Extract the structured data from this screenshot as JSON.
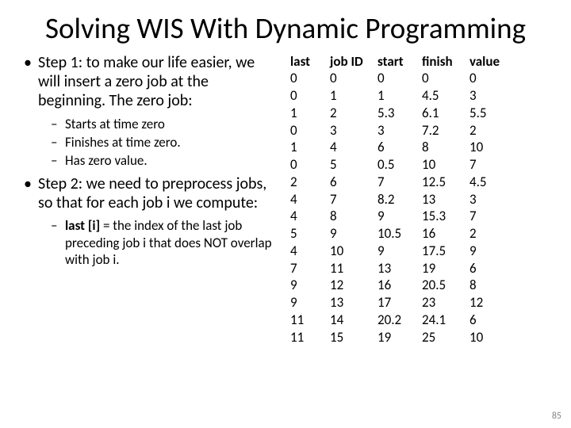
{
  "title": "Solving WIS With Dynamic Programming",
  "page_number": "85",
  "bullets": {
    "step1": {
      "text": "Step 1: to make our life easier, we will insert a zero job at the beginning. The zero job:",
      "sub": [
        "Starts at time zero",
        "Finishes at time zero.",
        "Has zero value."
      ]
    },
    "step2": {
      "text": "Step 2: we need to preprocess jobs, so that for each job i we compute:",
      "sub_prefix": "last [i]",
      "sub_rest": " = the index of the last job preceding job i that does NOT overlap with job i."
    }
  },
  "table": {
    "headers": [
      "last",
      "job ID",
      "start",
      "finish",
      "value"
    ],
    "rows": [
      [
        "0",
        "0",
        "0",
        "0",
        "0"
      ],
      [
        "0",
        "1",
        "1",
        "4.5",
        "3"
      ],
      [
        "1",
        "2",
        "5.3",
        "6.1",
        "5.5"
      ],
      [
        "0",
        "3",
        "3",
        "7.2",
        "2"
      ],
      [
        "1",
        "4",
        "6",
        "8",
        "10"
      ],
      [
        "0",
        "5",
        "0.5",
        "10",
        "7"
      ],
      [
        "2",
        "6",
        "7",
        "12.5",
        "4.5"
      ],
      [
        "4",
        "7",
        "8.2",
        "13",
        "3"
      ],
      [
        "4",
        "8",
        "9",
        "15.3",
        "7"
      ],
      [
        "5",
        "9",
        "10.5",
        "16",
        "2"
      ],
      [
        "4",
        "10",
        "9",
        "17.5",
        "9"
      ],
      [
        "7",
        "11",
        "13",
        "19",
        "6"
      ],
      [
        "9",
        "12",
        "16",
        "20.5",
        "8"
      ],
      [
        "9",
        "13",
        "17",
        "23",
        "12"
      ],
      [
        "11",
        "14",
        "20.2",
        "24.1",
        "6"
      ],
      [
        "11",
        "15",
        "19",
        "25",
        "10"
      ]
    ]
  },
  "chart_data": {
    "type": "table",
    "title": "Jobs table for Weighted Interval Scheduling",
    "columns": [
      "last",
      "job ID",
      "start",
      "finish",
      "value"
    ],
    "rows": [
      [
        0,
        0,
        0,
        0,
        0
      ],
      [
        0,
        1,
        1,
        4.5,
        3
      ],
      [
        1,
        2,
        5.3,
        6.1,
        5.5
      ],
      [
        0,
        3,
        3,
        7.2,
        2
      ],
      [
        1,
        4,
        6,
        8,
        10
      ],
      [
        0,
        5,
        0.5,
        10,
        7
      ],
      [
        2,
        6,
        7,
        12.5,
        4.5
      ],
      [
        4,
        7,
        8.2,
        13,
        3
      ],
      [
        4,
        8,
        9,
        15.3,
        7
      ],
      [
        5,
        9,
        10.5,
        16,
        2
      ],
      [
        4,
        10,
        9,
        17.5,
        9
      ],
      [
        7,
        11,
        13,
        19,
        6
      ],
      [
        9,
        12,
        16,
        20.5,
        8
      ],
      [
        9,
        13,
        17,
        23,
        12
      ],
      [
        11,
        14,
        20.2,
        24.1,
        6
      ],
      [
        11,
        15,
        19,
        25,
        10
      ]
    ]
  }
}
